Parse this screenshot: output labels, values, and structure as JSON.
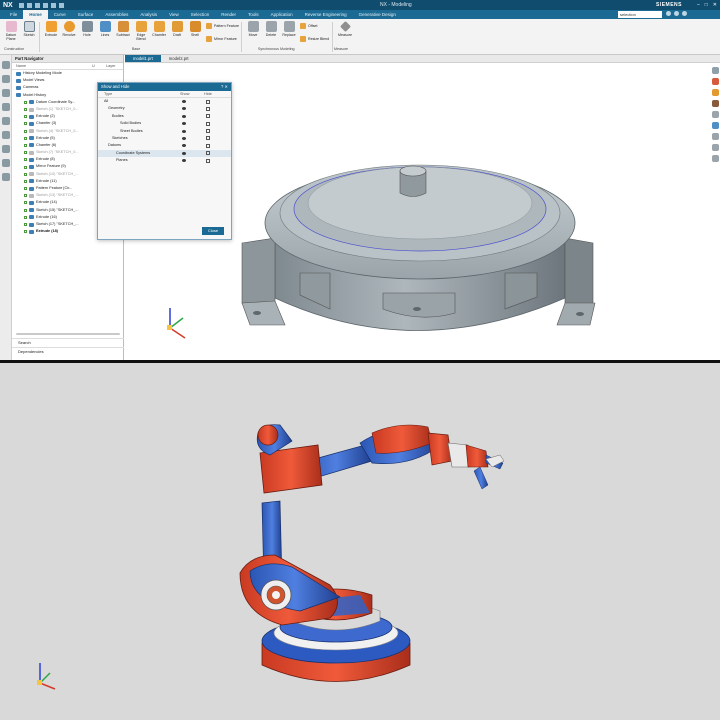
{
  "titlebar": {
    "app": "NX",
    "window_title": "NX - Modeling",
    "brand": "SIEMENS",
    "window_controls": [
      "–",
      "□",
      "✕"
    ]
  },
  "menu": {
    "tabs": [
      "File",
      "Home",
      "Curve",
      "Surface",
      "Assemblies",
      "Analysis",
      "View",
      "Selection",
      "Render",
      "Tools",
      "Application",
      "Reverse Engineering",
      "Generative Design"
    ],
    "active_tab": "Home",
    "search_value": "selection"
  },
  "ribbon": {
    "buttons": [
      "Datum Plane",
      "Sketch",
      "Extrude",
      "Revolve",
      "Hole",
      "Lines",
      "Subtract",
      "Edge Blend",
      "Chamfer",
      "Draft",
      "Shell"
    ],
    "small_buttons": [
      "Pattern Feature",
      "Mirror Feature",
      "Move",
      "Delete",
      "Replace",
      "Offset",
      "Resize Blend",
      "Measure"
    ],
    "groups": [
      "Construction",
      "Base",
      "Synchronous Modeling",
      "Measure"
    ]
  },
  "navigator": {
    "title": "Part Navigator",
    "columns": [
      "Name",
      "U",
      "Layer"
    ],
    "rows": [
      {
        "label": "History Modeling Mode",
        "ghost": false
      },
      {
        "label": "Model Views",
        "ghost": false
      },
      {
        "label": "Cameras",
        "ghost": false
      },
      {
        "label": "Model History",
        "ghost": false
      },
      {
        "label": "Datum Coordinate Sy...",
        "ghost": false
      },
      {
        "label": "Sketch (1) \"SKETCH_0...",
        "ghost": true
      },
      {
        "label": "Extrude (2)",
        "ghost": false
      },
      {
        "label": "Chamfer (3)",
        "ghost": false
      },
      {
        "label": "Sketch (4) \"SKETCH_0...",
        "ghost": true
      },
      {
        "label": "Extrude (5)",
        "ghost": false
      },
      {
        "label": "Chamfer (6)",
        "ghost": false
      },
      {
        "label": "Sketch (7) \"SKETCH_0...",
        "ghost": true
      },
      {
        "label": "Extrude (8)",
        "ghost": false
      },
      {
        "label": "Mirror Feature (9)",
        "ghost": false
      },
      {
        "label": "Sketch (10) \"SKETCH_...",
        "ghost": true
      },
      {
        "label": "Extrude (11)",
        "ghost": false
      },
      {
        "label": "Pattern Feature [Cir...",
        "ghost": false
      },
      {
        "label": "Sketch (13) \"SKETCH_...",
        "ghost": true
      },
      {
        "label": "Extrude (14)",
        "ghost": false
      },
      {
        "label": "Sketch (15) \"SKETCH_...",
        "ghost": false
      },
      {
        "label": "Extrude (16)",
        "ghost": false
      },
      {
        "label": "Sketch (17) \"SKETCH_...",
        "ghost": false
      },
      {
        "label": "Extrude (18)",
        "ghost": false
      }
    ],
    "footer": [
      "Search",
      "Dependencies"
    ]
  },
  "viewport": {
    "tabs": [
      "model1.prt",
      "model2.prt"
    ],
    "active_tab": "model1.prt"
  },
  "dialog": {
    "title": "Show and Hide",
    "columns": [
      "Type",
      "Show",
      "Hide"
    ],
    "rows": [
      "All",
      "Geometry",
      "Bodies",
      "Solid Bodies",
      "Sheet Bodies",
      "Sketches",
      "Datums",
      "Coordinate Systems",
      "Planes"
    ],
    "selected_row": 7,
    "ok_label": "Close"
  },
  "colors": {
    "accent": "#1a6a93",
    "robot_red": "#e04b2b",
    "robot_blue": "#2f63c8",
    "cad_gray": "#9aa4a9"
  },
  "icons": {
    "triad_top": "view-triad-icon",
    "triad_bottom": "view-triad-icon"
  }
}
